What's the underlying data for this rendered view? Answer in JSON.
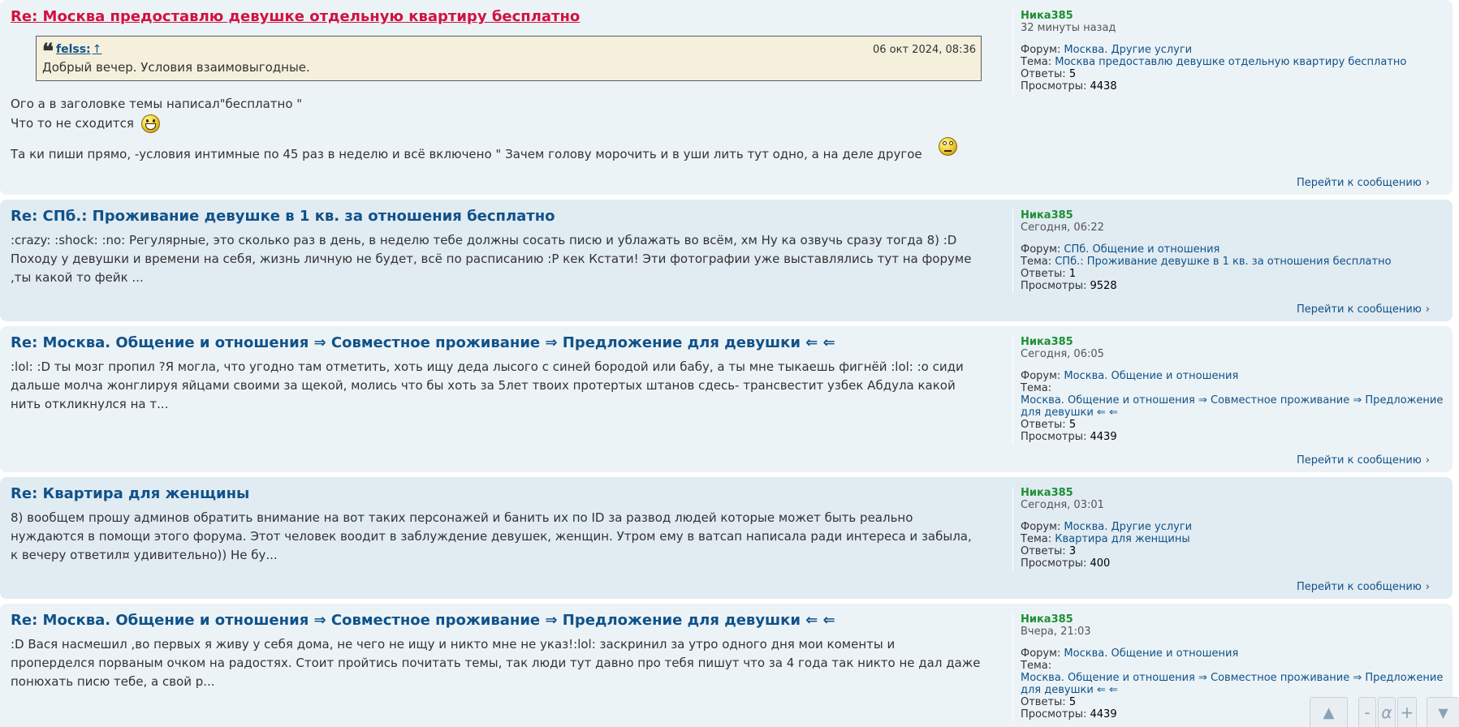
{
  "labels": {
    "forum": "Форум:",
    "topic": "Тема:",
    "replies": "Ответы:",
    "views": "Просмотры:",
    "jump": "Перейти к сообщению"
  },
  "posts": [
    {
      "title": "Re: Москва предоставлю девушке отдельную квартиру бесплатно",
      "quote": {
        "author": "felss:",
        "up": "↑",
        "date": "06 окт 2024, 08:36",
        "text": "Добрый вечер. Условия взаимовыгодные."
      },
      "lines": [
        "Ого а в заголовке темы написал\"бесплатно \"",
        "Что то не сходится",
        "Та ки пиши прямо, -условия интимные по 45 раз в неделю и всё включено \" Зачем голову морочить и в уши лить тут одно, а на деле другое"
      ],
      "author": "Ника385",
      "time": "32 минуты назад",
      "forum": "Москва. Другие услуги",
      "topic": "Москва предоставлю девушке отдельную квартиру бесплатно",
      "replies": "5",
      "views": "4438"
    },
    {
      "title": "Re: СПб.: Проживание девушке в 1 кв. за отношения бесплатно",
      "excerpt": ":crazy: :shock: :no: Регулярные, это сколько раз в день, в неделю тебе должны сосать писю и ублажать во всём, хм Ну ка озвучь сразу тогда 8) :D Походу у девушки и времени на себя, жизнь личную не будет, всё по расписанию :P кек Кстати! Эти фотографии уже выставлялись тут на форуме ,ты какой то фейк ...",
      "author": "Ника385",
      "time": "Сегодня, 06:22",
      "forum": "СПб. Общение и отношения",
      "topic": "СПб.: Проживание девушке в 1 кв. за отношения бесплатно",
      "replies": "1",
      "views": "9528"
    },
    {
      "title": "Re: Москва. Общение и отношения ⇒ Совместное проживание ⇒ Предложение для девушки ⇐ ⇐",
      "excerpt": ":lol: :D ты мозг пропил ?Я могла, что угодно там отметить, хоть ищу деда лысого с синей бородой или бабу, а ты мне тыкаешь фигнёй :lol: :o сиди дальше молча жонглируя яйцами своими за щекой, молись что бы хоть за 5лет твоих протертых штанов сдесь- трансвестит узбек Абдула какой нить откликнулся на т...",
      "author": "Ника385",
      "time": "Сегодня, 06:05",
      "forum": "Москва. Общение и отношения",
      "topic": "Москва. Общение и отношения ⇒ Совместное проживание ⇒ Предложение для девушки ⇐ ⇐",
      "replies": "5",
      "views": "4439"
    },
    {
      "title": "Re: Квартира для женщины",
      "excerpt": "8) вообщем прошу админов обратить внимание на вот таких персонажей и банить их по ID за развод людей которые может быть реально нуждаются в помощи этого форума. Этот человек воодит в заблуждение девушек, женщин. Утром ему в ватсап написала ради интереса и забыла, к вечеру ответил¤ удивительно)) Не бу...",
      "author": "Ника385",
      "time": "Сегодня, 03:01",
      "forum": "Москва. Другие услуги",
      "topic": "Квартира для женщины",
      "replies": "3",
      "views": "400"
    },
    {
      "title": "Re: Москва. Общение и отношения ⇒ Совместное проживание ⇒ Предложение для девушки ⇐ ⇐",
      "excerpt": ":D Вася насмешил ,во первых я живу у себя дома, не чего не ищу и никто мне не указ!:lol: заскринил за утро одного дня мои коменты и проперделся порваным очком на радостях. Стоит пройтись почитать темы, так люди тут давно про тебя пишут что за 4 года так никто не дал даже понюхать писю тебе, а свой р...",
      "author": "Ника385",
      "time": "Вчера, 21:03",
      "forum": "Москва. Общение и отношения",
      "topic": "Москва. Общение и отношения ⇒ Совместное проживание ⇒ Предложение для девушки ⇐ ⇐",
      "replies": "5",
      "views": "4439"
    }
  ],
  "floating_toolbar": {
    "up": "▲",
    "minus": "-",
    "alpha": "α",
    "plus": "+",
    "down": "▼"
  },
  "colors": {
    "row_light": "#ecf3f7",
    "row_dark": "#e1ebf2",
    "link": "#105289",
    "highlight": "#d31141",
    "author": "#1f8f33",
    "quote_bg": "#f4f0dc"
  }
}
